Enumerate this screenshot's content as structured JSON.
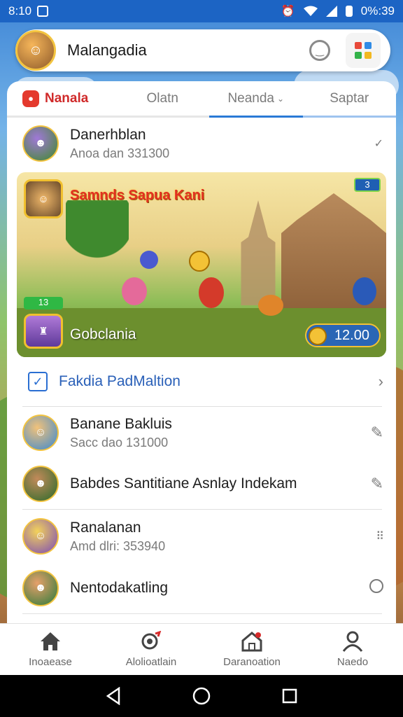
{
  "status_bar": {
    "time": "8:10",
    "battery": "0%:39"
  },
  "header": {
    "title": "Malangadia"
  },
  "tabs": [
    {
      "label": "Nanala"
    },
    {
      "label": "Olatn"
    },
    {
      "label": "Neanda"
    },
    {
      "label": "Saptar"
    }
  ],
  "list_top": {
    "primary": "Danerhblan",
    "secondary": "Anoa dan 331300"
  },
  "banner": {
    "title": "Samnds Sapua Kani",
    "footer_label": "Gobclania",
    "score": "12.00",
    "level_chip": "13",
    "top_chip": "3"
  },
  "link_row": {
    "label": "Fakdia PadMaltion"
  },
  "list_items": [
    {
      "primary": "Banane Bakluis",
      "secondary": "Sacc dao 131000",
      "trail_icon": "edit-icon"
    },
    {
      "primary": "Babdes Santitiane Asnlay Indekam",
      "secondary": "",
      "trail_icon": "edit-icon"
    },
    {
      "primary": "Ranalanan",
      "secondary": "Amd dlri: 353940",
      "trail_icon": "more-dots-icon"
    },
    {
      "primary": "Nentodakatling",
      "secondary": "",
      "trail_icon": "radio-icon"
    }
  ],
  "bottom_nav": [
    {
      "label": "Inoaease",
      "icon": "home-icon"
    },
    {
      "label": "Alolioatlain",
      "icon": "search-target-icon"
    },
    {
      "label": "Daranoation",
      "icon": "house-icon"
    },
    {
      "label": "Naedo",
      "icon": "person-icon"
    }
  ],
  "colors": {
    "accent_blue": "#2a7ad6",
    "status_bar": "#1c64c4",
    "tab_red": "#d02a2a",
    "gold": "#f1c02e"
  }
}
